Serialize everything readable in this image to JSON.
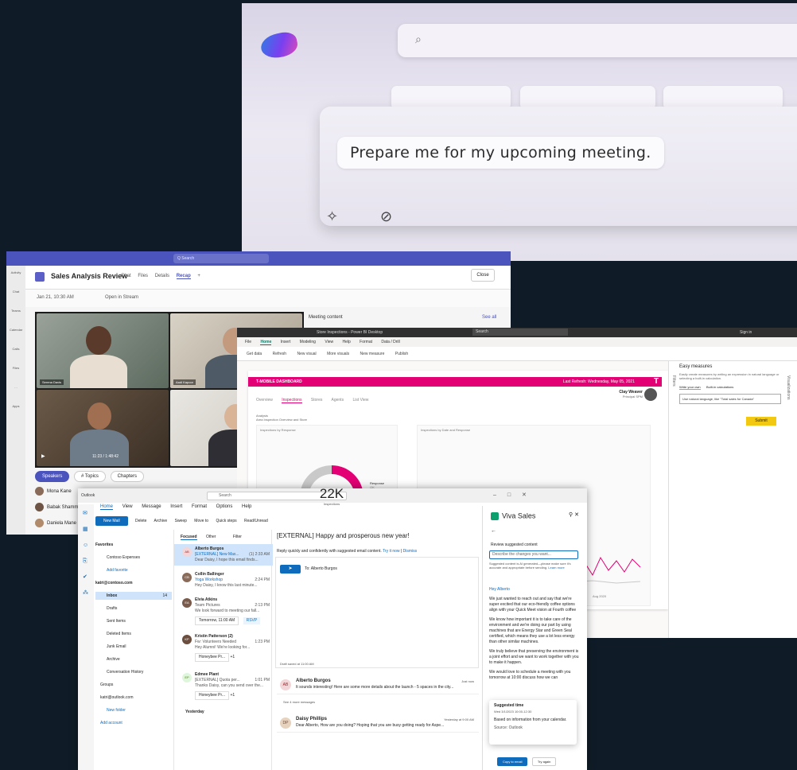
{
  "copilot": {
    "prompt": "Prepare me for my upcoming meeting.",
    "search_icon": "⌕",
    "sparkle_icon": "✧",
    "attach_icon": "⊘"
  },
  "teams": {
    "search": "Q Search",
    "meeting_title": "Sales Analysis Review",
    "tabs": [
      "Chat",
      "Files",
      "Details",
      "Recap",
      "+"
    ],
    "active_tab": "Recap",
    "date": "Jan 21, 10:30 AM",
    "open_in_stream": "Open in Stream",
    "close": "Close",
    "participants": [
      "Serena Davis",
      "Aadi Kapoor"
    ],
    "time": "11:23 / 1:48:42",
    "chips": [
      "Speakers",
      "# Topics",
      "Chapters"
    ],
    "speakers": [
      "Mona Kane",
      "Babak Shamm",
      "Daniela Mane"
    ],
    "meeting_content": "Meeting content",
    "see_all": "See all",
    "rail": [
      "Activity",
      "Chat",
      "Teams",
      "Calendar",
      "Calls",
      "Files",
      "…",
      "Apps"
    ]
  },
  "powerbi": {
    "window_title": "Store Inspections - Power BI Desktop",
    "search": "Search",
    "sign_in": "Sign in",
    "menu": [
      "File",
      "Home",
      "Insert",
      "Modeling",
      "View",
      "Help",
      "Format",
      "Data / Drill"
    ],
    "active_menu": "Home",
    "ribbon": [
      "Get data",
      "Refresh",
      "New visual",
      "More visuals",
      "New measure",
      "Publish"
    ],
    "banner": "T-MOBILE DASHBOARD",
    "last_refresh": "Last Refresh: Wednesday, May 05, 2021",
    "page_tabs": [
      "Overview",
      "Inspections",
      "Stores",
      "Agents",
      "List View"
    ],
    "active_page": "Inspections",
    "user_name": "Clay Weaver",
    "user_role": "Principal SPM",
    "analysis": "Analysis",
    "analysis_sub": "Area Inspection Overview and Store",
    "card1_title": "Inspections by Response",
    "card2_title": "Inspections by Date and Response",
    "kpi_value": "22K",
    "kpi_label": "Inspections",
    "donut_share": 0.62,
    "legend_title": "Response",
    "legend_items": [
      "OK",
      "Issue"
    ],
    "axis_label": "Aug 2020",
    "easy_title": "Easy measures",
    "easy_desc": "Easily create measures by writing an expression in natural language or selecting a built-in calculation.",
    "easy_tabs": [
      "Write your own",
      "Built-in calculations"
    ],
    "easy_input": "Use natural language, like \"Total sales for Canada\"",
    "submit": "Submit",
    "filters": "Filters",
    "visualizations": "Visualizations"
  },
  "outlook": {
    "app": "Outlook",
    "search": "Search",
    "menu": [
      "Home",
      "View",
      "Message",
      "Insert",
      "Format",
      "Options",
      "Help"
    ],
    "active_menu": "Home",
    "new_mail": "New Mail",
    "ribbon": [
      "Delete",
      "Archive",
      "Sweep",
      "Move to",
      "Quick steps",
      "Read/Unread"
    ],
    "folders": {
      "favorites": "Favorites",
      "contoso_expenses": "Contoso Expenses",
      "add_favorite": "Add favorite",
      "account1": "katri@contoso.com",
      "inbox": "Inbox",
      "inbox_count": "14",
      "drafts": "Drafts",
      "sent": "Sent Items",
      "deleted": "Deleted Items",
      "junk": "Junk Email",
      "archive": "Archive",
      "conv_history": "Conversation History",
      "groups": "Groups",
      "account2": "katri@outlook.com",
      "new_folder": "New folder",
      "add_account": "Add account"
    },
    "list_tabs": [
      "Focused",
      "Other",
      "Filter"
    ],
    "mails": [
      {
        "from": "Alberto Burgos",
        "subject": "[EXTERNAL] New Max...",
        "time": "(1) 2:33 AM",
        "preview": "Dear Daisy, I hope this email finds...",
        "initials": "AB",
        "color": "#a4262c"
      },
      {
        "from": "Collin Ballinger",
        "subject": "Yoga Workshop",
        "time": "2:24 PM",
        "preview": "Hey Daisy, I know this last minute...",
        "initials": "CB",
        "color": "#8a6b5a"
      },
      {
        "from": "Elvia Atkins",
        "subject": "Team Pictures",
        "time": "2:13 PM",
        "preview": "We look forward to meeting our fall...",
        "initials": "EA",
        "color": "#7a5a4a"
      },
      {
        "from": "Kristin Patterson (2)",
        "subject": "Fw: Volunteers Needed",
        "time": "1:23 PM",
        "preview": "Hey Alumni! We're looking for...",
        "initials": "KP",
        "color": "#6b4e3d"
      },
      {
        "from": "Edmee Plant",
        "subject": "[EXTERNAL] Quota per...",
        "time": "1:01 PM",
        "preview": "Thanks Daisy, can you send over the...",
        "initials": "EP",
        "color": "#498205"
      }
    ],
    "rsvp_time": "Tomorrow, 11:00 AM",
    "rsvp": "RSVP",
    "attachment": "Honeybee Pr...",
    "attachment_more": "+1",
    "yesterday": "Yesterday",
    "subject": "[EXTERNAL] Happy and prosperous new year!",
    "suggest": "Reply quickly and confidently with suggested email content.",
    "try_it": "Try it now",
    "dismiss": "Dismiss",
    "to": "To: Alberto Burgos",
    "draft_saved": "Draft saved at 11:00 AM",
    "thread1_from": "Alberto Burgos",
    "thread1_preview": "It sounds interesting! Here are some more details about the launch - 5 spaces in the city...",
    "thread1_time": "Just now",
    "more_messages": "See 4 more messages",
    "thread2_from": "Daisy Phillips",
    "thread2_preview": "Dear Alberto, How are you doing? Hoping that you are busy getting ready for Aspe...",
    "thread2_time": "Yesterday at 9:00 AM"
  },
  "viva": {
    "title": "Viva Sales",
    "review": "Review suggested content",
    "describe": "Describe the changes you want...",
    "note": "Suggested content is AI generated—please make sure it's accurate and appropriate before sending.",
    "learn_more": "Learn more",
    "greeting": "Hey Alberto",
    "p1": "We just wanted to reach out and say that we're super excited that our eco-friendly coffee options align with your Quick Meet vision at Fourth coffee",
    "p2": "We know how important it is to take care of the environment and we're doing our part by using machines that are Energy Star and Green Seal certified, which means they use a lot less energy than other similar machines.",
    "p3": "We truly believe that preserving the environment is a joint effort and we want to work together with you to make it happen.",
    "p4": "We would love to schedule a meeting with you tomorrow at 10:00 discuss how we can",
    "sugg_time": "Suggested time",
    "sugg_date": "Wed 3/1/2023 10:00-12:30",
    "based_on": "Based on information from your calendar.",
    "source": "Source: Outlook",
    "copy": "Copy to email",
    "try_again": "Try again"
  }
}
